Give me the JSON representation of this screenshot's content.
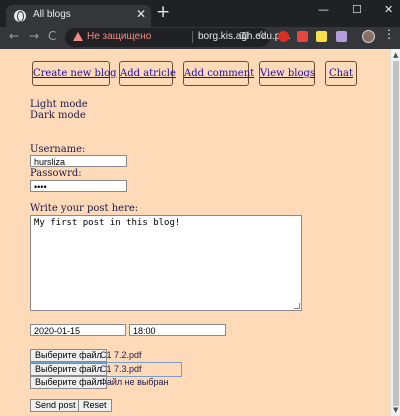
{
  "browser": {
    "tab_title": "All blogs",
    "tab_close": "✕",
    "new_tab": "+",
    "window_controls": {
      "minimize": "—",
      "maximize": "☐",
      "close": "✕"
    },
    "nav": {
      "back": "←",
      "forward": "→",
      "reload": "C"
    },
    "security_warning": "Не защищено",
    "url": "borg.kis.agh.edu.pl...",
    "menu": "⋮",
    "icons": [
      "warning-icon",
      "key-icon",
      "star-icon",
      "extension-icons",
      "avatar"
    ]
  },
  "page": {
    "nav_links": [
      "Create new blog",
      "Add atricle",
      "Add comment",
      "View blogs",
      "Chat"
    ],
    "modes": {
      "light": "Light mode",
      "dark": "Dark mode"
    },
    "username_label": "Username:",
    "username_value": "hursliza",
    "password_label": "Passowrd:",
    "password_value": "••••",
    "post_label": "Write your post here:",
    "post_value": "My first post in this blog!",
    "date_value": "2020-01-15",
    "time_value": "18:00",
    "file_button": "Выберите файл",
    "files": [
      "C1 7.2.pdf",
      "C1 7.3.pdf",
      "Файл не выбран"
    ],
    "send_button": "Send post",
    "reset_button": "Reset"
  },
  "colors": {
    "page_background": "#ffdab9",
    "link": "#1a0dab",
    "warning": "#f28b82"
  }
}
